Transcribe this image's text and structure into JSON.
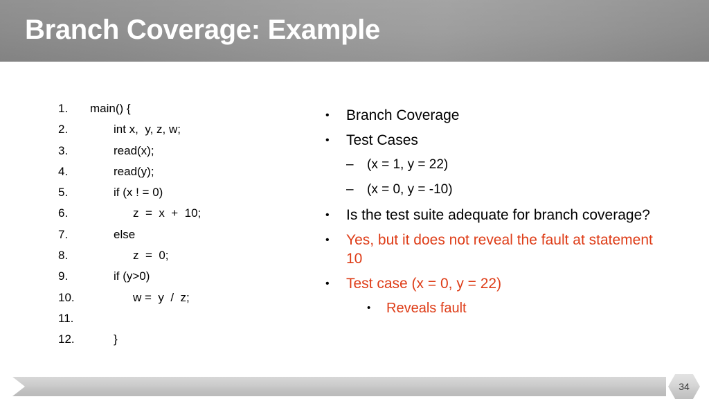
{
  "slide": {
    "title": "Branch Coverage: Example",
    "page_number": "34",
    "accent_red": "#DE3C17",
    "title_band_color": "#949494",
    "footer_ribbon_color": "#c9c9c9"
  },
  "code": {
    "lines": [
      {
        "num": "1.",
        "text": "main() {",
        "indent": 0
      },
      {
        "num": "2.",
        "text": "int x,  y, z, w;",
        "indent": 1
      },
      {
        "num": "3.",
        "text": "read(x);",
        "indent": 1
      },
      {
        "num": "4.",
        "text": "read(y);",
        "indent": 1
      },
      {
        "num": "5.",
        "text": "if (x ! = 0)",
        "indent": 1
      },
      {
        "num": "6.",
        "text": "z  =  x  +  10;",
        "indent": 2
      },
      {
        "num": "7.",
        "text": "else",
        "indent": 1
      },
      {
        "num": "8.",
        "text": "z  =  0;",
        "indent": 2
      },
      {
        "num": "9.",
        "text": "if (y>0)",
        "indent": 1
      },
      {
        "num": "10.",
        "text": "w =  y  /  z;",
        "indent": 2
      },
      {
        "num": "11.",
        "text": "",
        "indent": 1
      },
      {
        "num": "12.",
        "text": "}",
        "indent": 1
      }
    ]
  },
  "bullets": [
    {
      "level": 1,
      "marker": "•",
      "text": "Branch Coverage",
      "color": "black"
    },
    {
      "level": 1,
      "marker": "•",
      "text": "Test Cases",
      "color": "black"
    },
    {
      "level": 2,
      "marker": "–",
      "text": "(x = 1, y = 22)",
      "color": "black"
    },
    {
      "level": 2,
      "marker": "–",
      "text": "(x = 0, y = -10)",
      "color": "black"
    },
    {
      "level": 1,
      "marker": "•",
      "text": "Is the test suite  adequate for branch coverage?",
      "color": "black"
    },
    {
      "level": 1,
      "marker": "•",
      "text": "Yes, but it does not  reveal the fault at  statement 10",
      "color": "red"
    },
    {
      "level": 1,
      "marker": "•",
      "text": "Test case (x = 0, y = 22)",
      "color": "red"
    },
    {
      "level": 3,
      "marker": "•",
      "text": "Reveals fault",
      "color": "red"
    }
  ]
}
